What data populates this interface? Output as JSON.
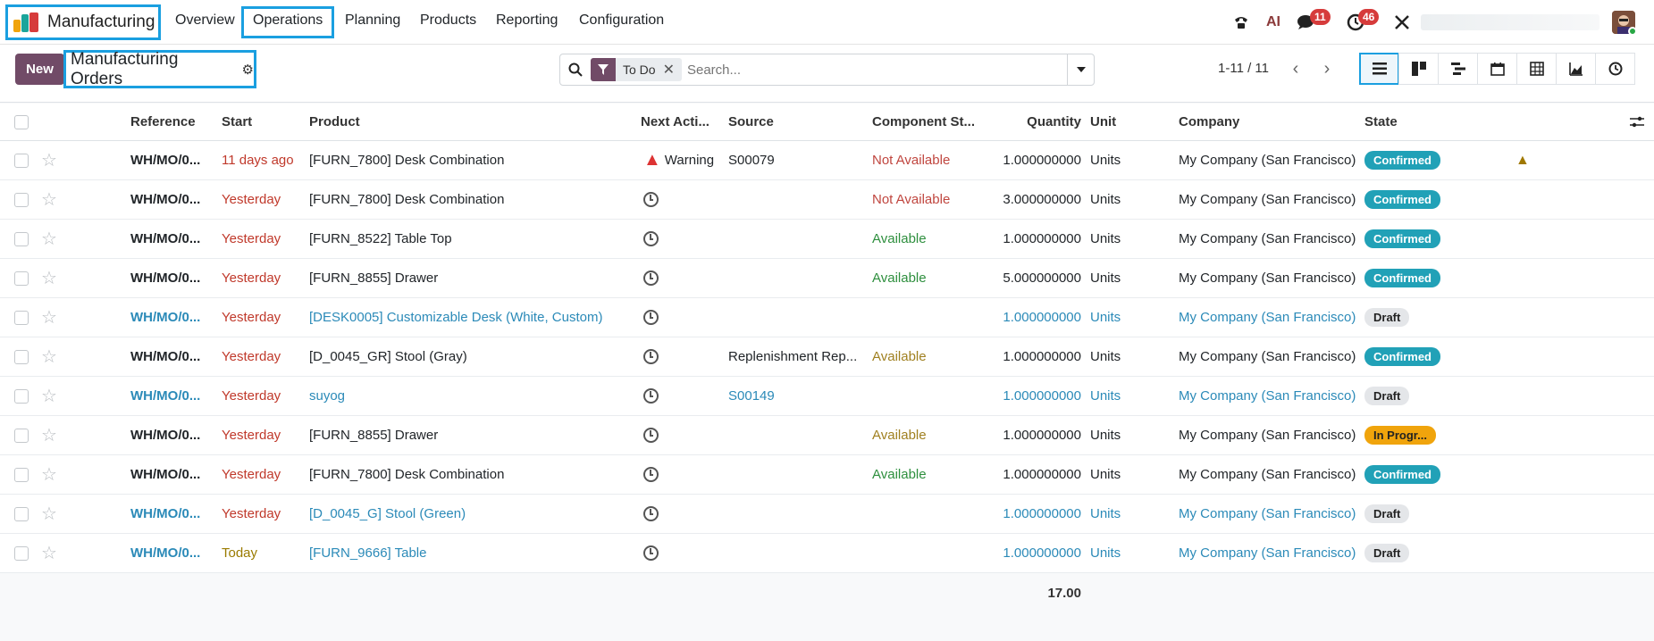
{
  "navbar": {
    "app_name": "Manufacturing",
    "menu": [
      "Overview",
      "Operations",
      "Planning",
      "Products",
      "Reporting",
      "Configuration"
    ],
    "active_menu": "Operations",
    "ai_label": "AI",
    "messages_count": "11",
    "activities_count": "46"
  },
  "control": {
    "new_label": "New",
    "title": "Manufacturing Orders",
    "facet": "To Do",
    "search_placeholder": "Search...",
    "pager": "1-11 / 11",
    "views": [
      "list-view",
      "kanban-view",
      "gantt-view",
      "calendar-view",
      "pivot-view",
      "graph-view",
      "activity-view"
    ],
    "active_view": "list-view"
  },
  "table": {
    "columns": [
      "Reference",
      "Start",
      "Product",
      "Next Acti...",
      "Source",
      "Component St...",
      "Quantity",
      "Unit",
      "Company",
      "State"
    ],
    "rows": [
      {
        "ref": "WH/MO/0...",
        "start": "11 days ago",
        "product": "[FURN_7800] Desk Combination",
        "activity": "Warning",
        "source": "S00079",
        "component": "Not Available",
        "qty": "1.000000000",
        "unit": "Units",
        "company": "My Company (San Francisco)",
        "state": "Confirmed"
      },
      {
        "ref": "WH/MO/0...",
        "start": "Yesterday",
        "product": "[FURN_7800] Desk Combination",
        "activity": "",
        "source": "",
        "component": "Not Available",
        "qty": "3.000000000",
        "unit": "Units",
        "company": "My Company (San Francisco)",
        "state": "Confirmed"
      },
      {
        "ref": "WH/MO/0...",
        "start": "Yesterday",
        "product": "[FURN_8522] Table Top",
        "activity": "",
        "source": "",
        "component": "Available",
        "qty": "1.000000000",
        "unit": "Units",
        "company": "My Company (San Francisco)",
        "state": "Confirmed"
      },
      {
        "ref": "WH/MO/0...",
        "start": "Yesterday",
        "product": "[FURN_8855] Drawer",
        "activity": "",
        "source": "",
        "component": "Available",
        "qty": "5.000000000",
        "unit": "Units",
        "company": "My Company (San Francisco)",
        "state": "Confirmed"
      },
      {
        "ref": "WH/MO/0...",
        "start": "Yesterday",
        "product": "[DESK0005] Customizable Desk (White, Custom)",
        "activity": "",
        "source": "",
        "component": "",
        "qty": "1.000000000",
        "unit": "Units",
        "company": "My Company (San Francisco)",
        "state": "Draft"
      },
      {
        "ref": "WH/MO/0...",
        "start": "Yesterday",
        "product": "[D_0045_GR] Stool (Gray)",
        "activity": "",
        "source": "Replenishment Rep...",
        "component": "Available",
        "qty": "1.000000000",
        "unit": "Units",
        "company": "My Company (San Francisco)",
        "state": "Confirmed"
      },
      {
        "ref": "WH/MO/0...",
        "start": "Yesterday",
        "product": "suyog",
        "activity": "",
        "source": "S00149",
        "component": "",
        "qty": "1.000000000",
        "unit": "Units",
        "company": "My Company (San Francisco)",
        "state": "Draft"
      },
      {
        "ref": "WH/MO/0...",
        "start": "Yesterday",
        "product": "[FURN_8855] Drawer",
        "activity": "",
        "source": "",
        "component": "Available",
        "qty": "1.000000000",
        "unit": "Units",
        "company": "My Company (San Francisco)",
        "state": "In Progr..."
      },
      {
        "ref": "WH/MO/0...",
        "start": "Yesterday",
        "product": "[FURN_7800] Desk Combination",
        "activity": "",
        "source": "",
        "component": "Available",
        "qty": "1.000000000",
        "unit": "Units",
        "company": "My Company (San Francisco)",
        "state": "Confirmed"
      },
      {
        "ref": "WH/MO/0...",
        "start": "Yesterday",
        "product": "[D_0045_G] Stool (Green)",
        "activity": "",
        "source": "",
        "component": "",
        "qty": "1.000000000",
        "unit": "Units",
        "company": "My Company (San Francisco)",
        "state": "Draft"
      },
      {
        "ref": "WH/MO/0...",
        "start": "Today",
        "product": "[FURN_9666] Table",
        "activity": "",
        "source": "",
        "component": "",
        "qty": "1.000000000",
        "unit": "Units",
        "company": "My Company (San Francisco)",
        "state": "Draft"
      }
    ],
    "total_quantity": "17.00"
  },
  "colors": {
    "brand": "#714b67",
    "highlight": "#1a9fe0",
    "confirmed": "#21a1b7",
    "progress": "#f0a40c",
    "danger": "#c0392b"
  }
}
